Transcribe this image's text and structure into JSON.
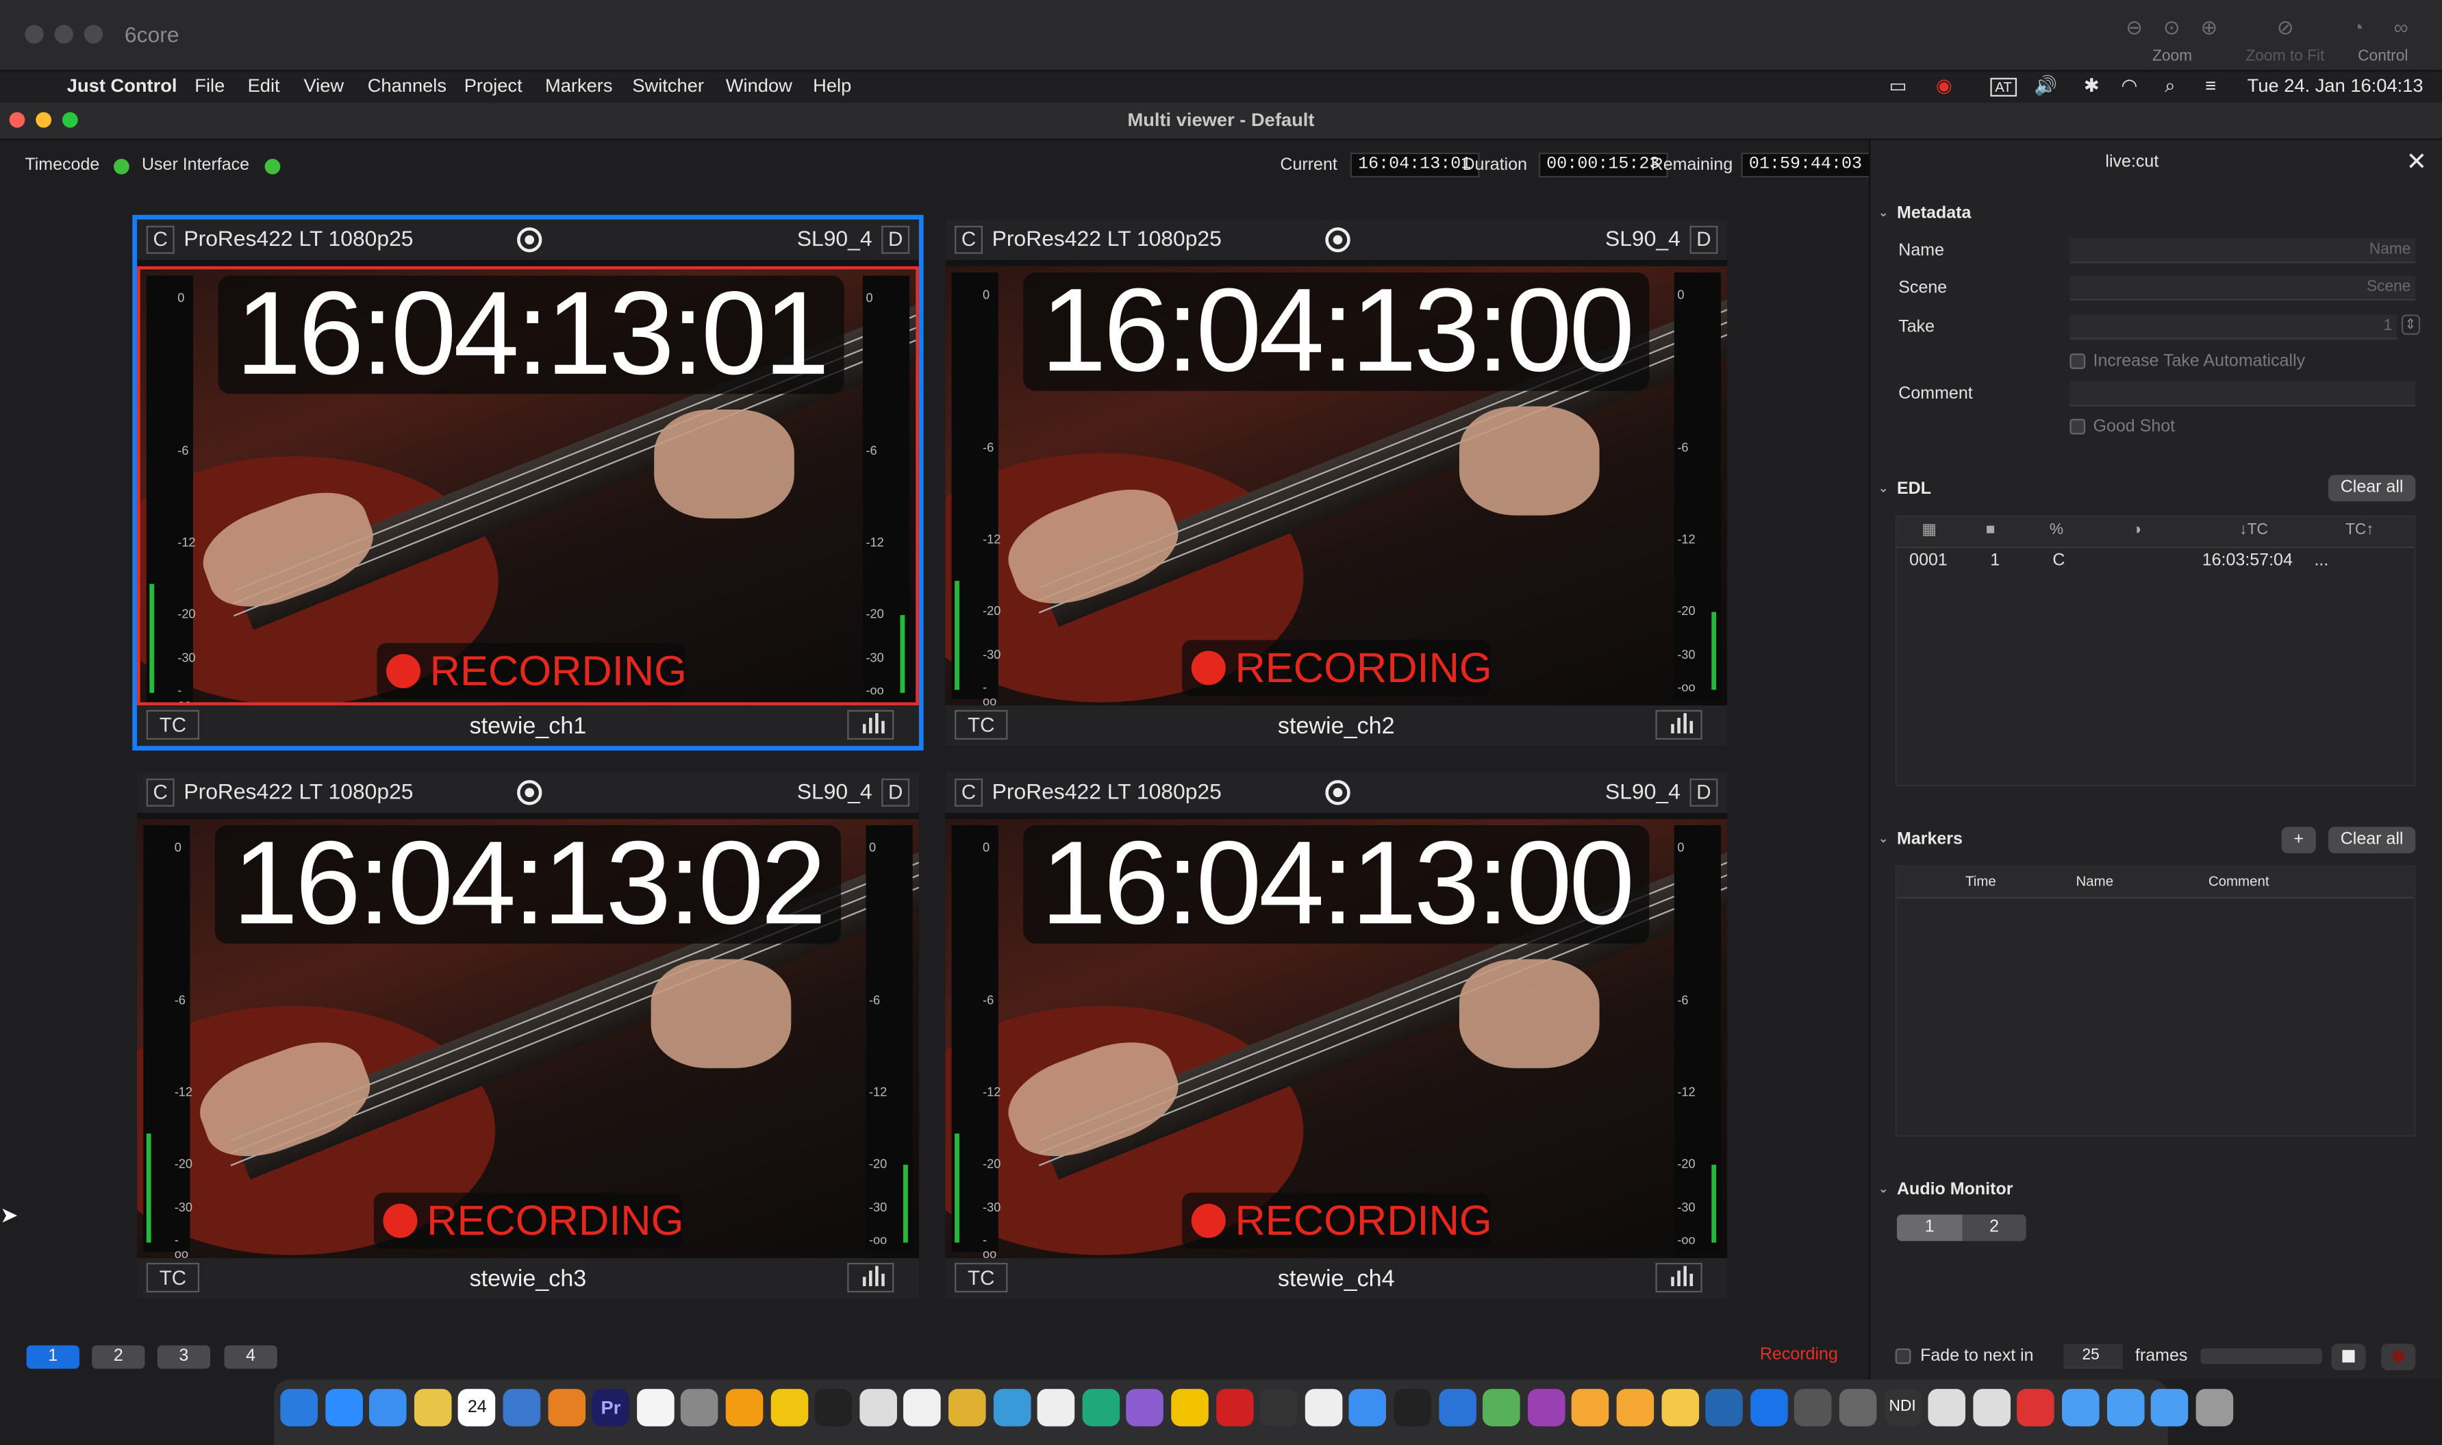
{
  "outer": {
    "title": "6core",
    "toolbar": [
      "Zoom",
      "Zoom to Fit",
      "Control"
    ]
  },
  "menubar": {
    "app": "Just Control",
    "items": [
      "File",
      "Edit",
      "View",
      "Channels",
      "Project",
      "Markers",
      "Switcher",
      "Window",
      "Help"
    ],
    "clock": "Tue 24. Jan  16:04:13",
    "status_glyph": "AT"
  },
  "window": {
    "title": "Multi viewer - Default"
  },
  "status": {
    "timecode_label": "Timecode",
    "ui_label": "User Interface",
    "current_label": "Current",
    "current_value": "16:04:13:01",
    "duration_label": "Duration",
    "duration_value": "00:00:15:23",
    "remaining_label": "Remaining",
    "remaining_value": "01:59:44:03"
  },
  "tiles": [
    {
      "c": "C",
      "format": "ProRes422 LT 1080p25",
      "slot": "SL90_4",
      "d": "D",
      "timecode": "16:04:13:01",
      "recording": "RECORDING",
      "tc": "TC",
      "name": "stewie_ch1",
      "selected": true
    },
    {
      "c": "C",
      "format": "ProRes422 LT 1080p25",
      "slot": "SL90_4",
      "d": "D",
      "timecode": "16:04:13:00",
      "recording": "RECORDING",
      "tc": "TC",
      "name": "stewie_ch2",
      "selected": false
    },
    {
      "c": "C",
      "format": "ProRes422 LT 1080p25",
      "slot": "SL90_4",
      "d": "D",
      "timecode": "16:04:13:02",
      "recording": "RECORDING",
      "tc": "TC",
      "name": "stewie_ch3",
      "selected": false
    },
    {
      "c": "C",
      "format": "ProRes422 LT 1080p25",
      "slot": "SL90_4",
      "d": "D",
      "timecode": "16:04:13:00",
      "recording": "RECORDING",
      "tc": "TC",
      "name": "stewie_ch4",
      "selected": false
    }
  ],
  "meter_ticks": [
    "0",
    "-6",
    "-12",
    "-20",
    "-30",
    "-oo"
  ],
  "pages": [
    "1",
    "2",
    "3",
    "4"
  ],
  "recording_status": "Recording",
  "panel": {
    "title": "live:cut",
    "metadata": {
      "header": "Metadata",
      "name_label": "Name",
      "name_placeholder": "Name",
      "scene_label": "Scene",
      "scene_placeholder": "Scene",
      "take_label": "Take",
      "take_value": "1",
      "increase_take": "Increase Take Automatically",
      "comment_label": "Comment",
      "good_shot": "Good Shot"
    },
    "edl": {
      "header": "EDL",
      "clear_all": "Clear all",
      "columns": [
        "",
        "",
        "%",
        "",
        "↓TC",
        "TC↑"
      ],
      "rows": [
        [
          "0001",
          "1",
          "C",
          "",
          "16:03:57:04",
          "..."
        ]
      ]
    },
    "markers": {
      "header": "Markers",
      "add": "+",
      "clear_all": "Clear all",
      "columns": [
        "Time",
        "Name",
        "Comment"
      ]
    },
    "audio": {
      "header": "Audio Monitor",
      "channels": [
        "1",
        "2"
      ]
    },
    "fade": {
      "label": "Fade to next in",
      "value": "25",
      "unit": "frames"
    }
  },
  "dock_text": {
    "pr": "Pr",
    "ndi": "NDI",
    "cal": "24"
  }
}
